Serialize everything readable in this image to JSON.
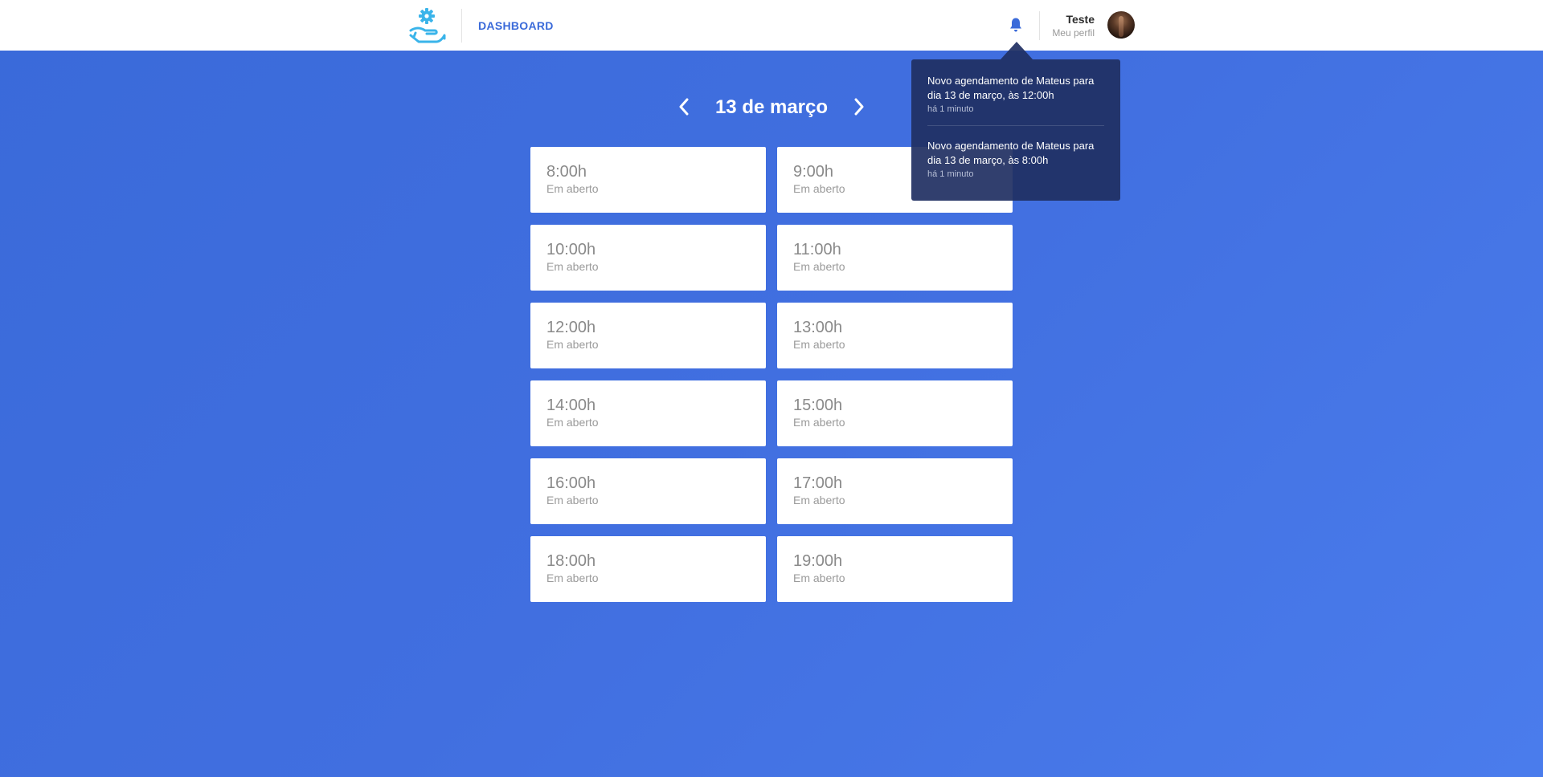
{
  "header": {
    "nav_label": "DASHBOARD",
    "profile_name": "Teste",
    "profile_link": "Meu perfil"
  },
  "icons": {
    "logo": "hand-gear-logo-icon",
    "notifications": "bell-icon",
    "prev": "chevron-left-icon",
    "next": "chevron-right-icon"
  },
  "colors": {
    "accent": "#3a6ad9",
    "logo": "#3ab4ea",
    "notif_bg": "#202f62"
  },
  "schedule": {
    "date": "13 de março",
    "slots": [
      {
        "time": "8:00h",
        "status": "Em aberto"
      },
      {
        "time": "9:00h",
        "status": "Em aberto"
      },
      {
        "time": "10:00h",
        "status": "Em aberto"
      },
      {
        "time": "11:00h",
        "status": "Em aberto"
      },
      {
        "time": "12:00h",
        "status": "Em aberto"
      },
      {
        "time": "13:00h",
        "status": "Em aberto"
      },
      {
        "time": "14:00h",
        "status": "Em aberto"
      },
      {
        "time": "15:00h",
        "status": "Em aberto"
      },
      {
        "time": "16:00h",
        "status": "Em aberto"
      },
      {
        "time": "17:00h",
        "status": "Em aberto"
      },
      {
        "time": "18:00h",
        "status": "Em aberto"
      },
      {
        "time": "19:00h",
        "status": "Em aberto"
      }
    ]
  },
  "notifications": [
    {
      "text": "Novo agendamento de Mateus para dia 13 de março, às 12:00h",
      "time": "há 1 minuto"
    },
    {
      "text": "Novo agendamento de Mateus para dia 13 de março, às 8:00h",
      "time": "há 1 minuto"
    }
  ]
}
